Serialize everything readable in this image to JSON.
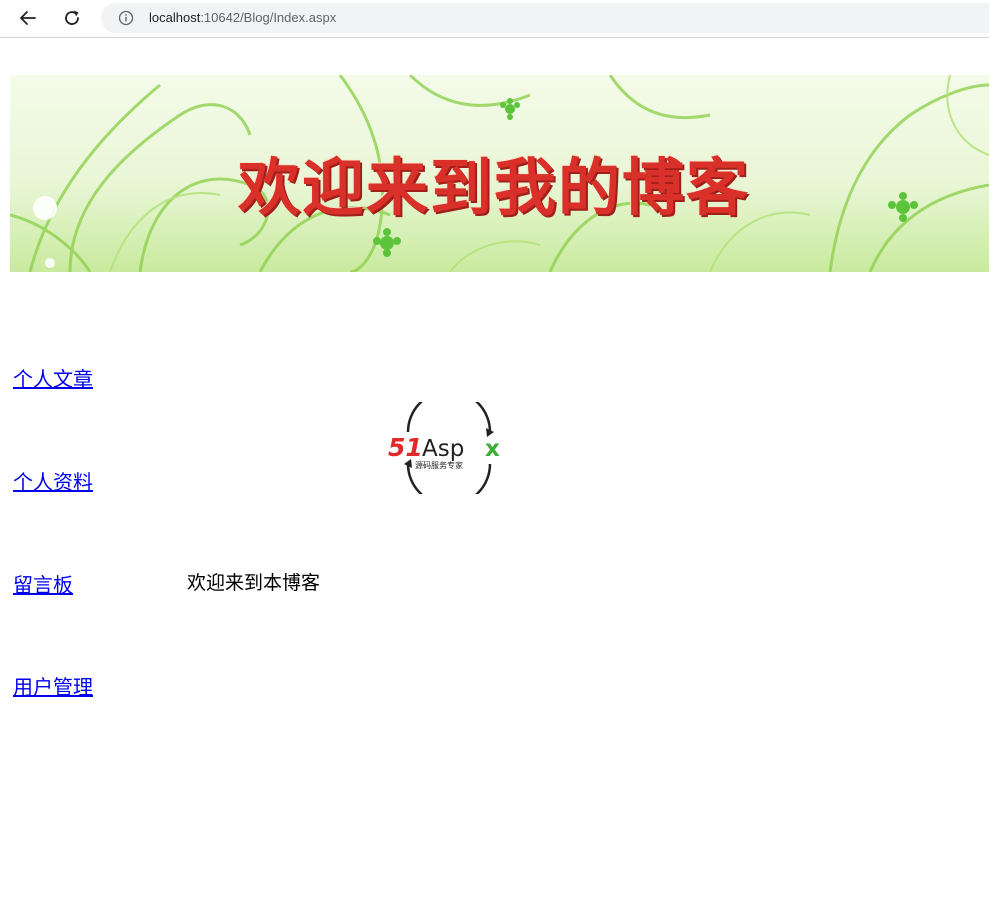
{
  "browser": {
    "url_host": "localhost",
    "url_rest": ":10642/Blog/Index.aspx"
  },
  "banner": {
    "title": "欢迎来到我的博客"
  },
  "nav": {
    "items": [
      {
        "label": "个人文章"
      },
      {
        "label": "个人资料"
      },
      {
        "label": "留言板"
      },
      {
        "label": "用户管理"
      }
    ]
  },
  "logo": {
    "brand": "51Aspx",
    "tagline": "源码服务专家"
  },
  "main": {
    "welcome_text": "欢迎来到本博客"
  },
  "colors": {
    "link": "#0000ee",
    "banner_title": "#d9302a",
    "banner_green": "#8fd14f"
  }
}
